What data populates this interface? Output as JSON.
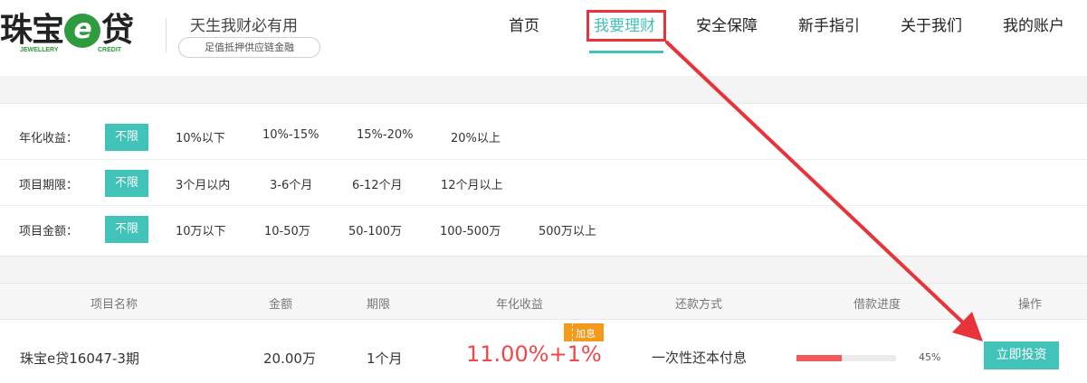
{
  "brand": {
    "logo_prefix": "珠宝",
    "logo_e": "e",
    "logo_suffix": "贷",
    "logo_sub_left": "JEWELLERY",
    "logo_sub_right": "CREDIT",
    "slogan": "天生我财必有用",
    "tagline": "足值抵押供应链金融"
  },
  "nav": {
    "items": [
      {
        "label": "首页"
      },
      {
        "label": "我要理财"
      },
      {
        "label": "安全保障"
      },
      {
        "label": "新手指引"
      },
      {
        "label": "关于我们"
      },
      {
        "label": "我的账户"
      }
    ],
    "active_index": 1
  },
  "filters": {
    "rate": {
      "label": "年化收益：",
      "options": [
        "不限",
        "10%以下",
        "10%-15%",
        "15%-20%",
        "20%以上"
      ],
      "selected": "不限"
    },
    "term": {
      "label": "项目期限：",
      "options": [
        "不限",
        "3个月以内",
        "3-6个月",
        "6-12个月",
        "12个月以上"
      ],
      "selected": "不限"
    },
    "amount": {
      "label": "项目金额：",
      "options": [
        "不限",
        "10万以下",
        "10-50万",
        "50-100万",
        "100-500万",
        "500万以上"
      ],
      "selected": "不限"
    }
  },
  "table": {
    "headers": [
      "项目名称",
      "金额",
      "期限",
      "年化收益",
      "还款方式",
      "借款进度",
      "操作"
    ],
    "rows": [
      {
        "name": "珠宝e贷16047-3期",
        "amount": "20.00万",
        "term": "1个月",
        "rate": "11.00%+1%",
        "bonus_tag": "加息",
        "repay": "一次性还本付息",
        "progress": 45,
        "progress_label": "45%",
        "action": "立即投资"
      }
    ]
  },
  "colors": {
    "accent": "#41c3b9",
    "rate_red": "#f04848",
    "progress_red": "#f05a5a",
    "bonus_orange": "#f39a1b",
    "annotation_red": "#e8333a"
  }
}
